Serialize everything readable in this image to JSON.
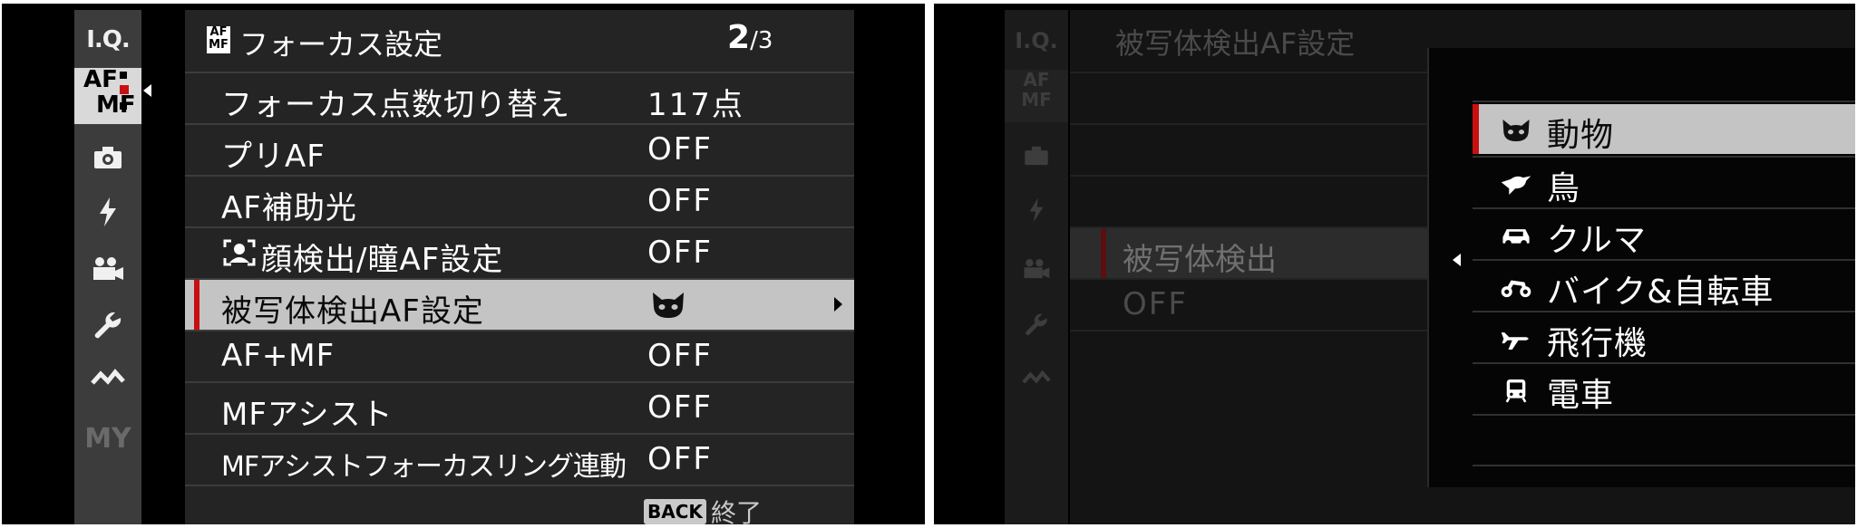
{
  "left_screen": {
    "sidebar": [
      {
        "id": "iq",
        "label": "I.Q."
      },
      {
        "id": "afmf",
        "label_top": "AF",
        "label_bottom": "MF"
      },
      {
        "id": "shooting",
        "icon": "camera-icon"
      },
      {
        "id": "flash",
        "icon": "flash-icon"
      },
      {
        "id": "movie",
        "icon": "movie-camera-icon"
      },
      {
        "id": "setup",
        "icon": "wrench-icon"
      },
      {
        "id": "connect",
        "icon": "connection-icon"
      },
      {
        "id": "my",
        "label": "MY"
      }
    ],
    "header": {
      "icon_top": "AF",
      "icon_bottom": "MF",
      "title": "フォーカス設定",
      "page_current": "2",
      "page_sep": "/",
      "page_total": "3"
    },
    "rows": [
      {
        "label": "フォーカス点数切り替え",
        "value": "117点"
      },
      {
        "label": "プリAF",
        "value": "OFF"
      },
      {
        "label": "AF補助光",
        "value": "OFF"
      },
      {
        "label": "顔検出/瞳AF設定",
        "value": "OFF",
        "icon": "face-detect-icon"
      },
      {
        "label": "被写体検出AF設定",
        "value_icon": "animal-icon",
        "selected": true
      },
      {
        "label": "AF+MF",
        "value": "OFF"
      },
      {
        "label": "MFアシスト",
        "value": "OFF"
      },
      {
        "label": "MFアシストフォーカスリング連動",
        "value": "OFF"
      }
    ],
    "footer": {
      "back_key": "BACK",
      "back_label": "終了"
    }
  },
  "right_screen": {
    "background_title": "被写体検出AF設定",
    "background_row_label": "被写体検出",
    "background_row_value": "OFF",
    "options": [
      {
        "label": "動物",
        "icon": "animal-icon",
        "selected": true
      },
      {
        "label": "鳥",
        "icon": "bird-icon"
      },
      {
        "label": "クルマ",
        "icon": "car-icon"
      },
      {
        "label": "バイク&自転車",
        "icon": "motorcycle-icon"
      },
      {
        "label": "飛行機",
        "icon": "airplane-icon"
      },
      {
        "label": "電車",
        "icon": "train-icon"
      }
    ]
  },
  "colors": {
    "accent": "#c81010",
    "selected_bg": "#c4c4c4",
    "menu_bg": "#242424",
    "sidebar_bg": "#3c3c3c"
  }
}
